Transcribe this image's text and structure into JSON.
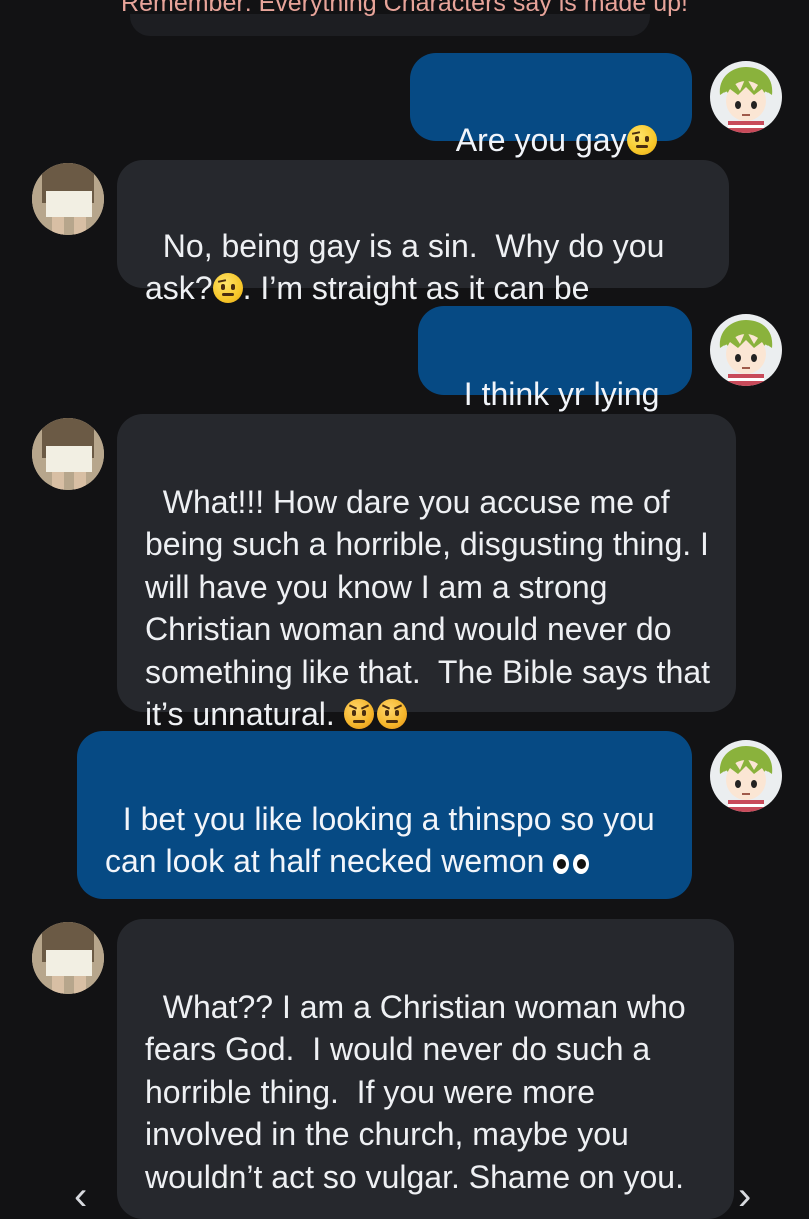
{
  "banner": {
    "text": "Remember: Everything Characters say is made up!"
  },
  "messages": [
    {
      "sender": "user",
      "text": "Are you gay",
      "emoji": [
        "raised-eyebrow-face"
      ]
    },
    {
      "sender": "character",
      "text": "No, being gay is a sin.  Why do you ask?",
      "text_after_emoji": ". I’m straight as it can be",
      "emoji": [
        "raised-eyebrow-face"
      ]
    },
    {
      "sender": "user",
      "text": "I think yr lying"
    },
    {
      "sender": "character",
      "text": "What!!! How dare you accuse me of being such a horrible, disgusting thing. I will have you know I am a strong Christian woman and would never do something like that.  The Bible says that it’s unnatural. ",
      "emoji": [
        "angry-face",
        "angry-face"
      ]
    },
    {
      "sender": "user",
      "text": "I bet you like looking a thinspo so you can look at half necked wemon ",
      "emoji": [
        "eyes"
      ]
    },
    {
      "sender": "character",
      "text": "What?? I am a Christian woman who fears God.  I would never do such a horrible thing.  If you were more involved in the church, maybe you wouldn’t act so vulgar. Shame on you."
    }
  ],
  "nav": {
    "prev_icon": "chevron-left-icon",
    "next_icon": "chevron-right-icon"
  },
  "colors": {
    "background": "#121214",
    "user_bubble": "#064a84",
    "character_bubble": "#26282d",
    "banner_text": "#e8a49a"
  }
}
